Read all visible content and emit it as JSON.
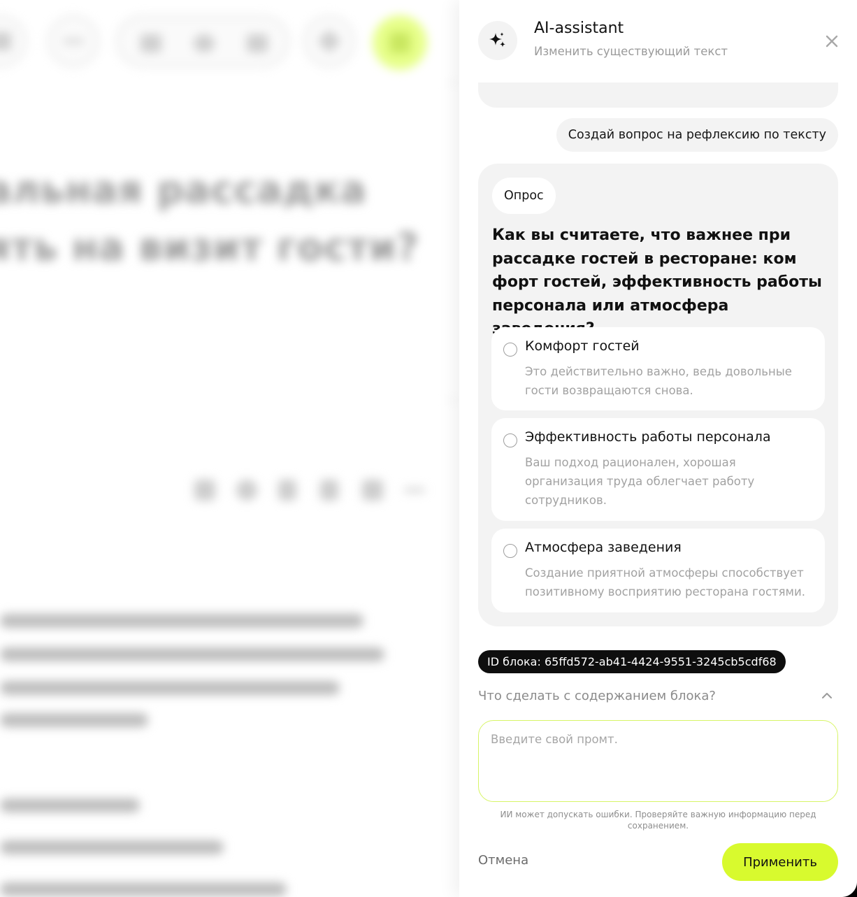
{
  "background": {
    "title_lines": [
      "альная рассадка",
      "ять на визит гости?"
    ],
    "colors": {
      "accent": "#d8fa2e",
      "accent_soft": "#e7ff8a"
    }
  },
  "assistant": {
    "title": "AI-assistant",
    "subtitle": "Изменить существующий текст",
    "icons": {
      "logo": "sparkle-icon",
      "close": "close-icon",
      "collapse": "chevron-up-icon"
    },
    "user_message": "Создай вопрос на рефлексию по тексту",
    "poll": {
      "tag": "Опрос",
      "question": "Как вы считаете, что важнее при рассадке гостей в ресторане: ком форт гостей, эффективность работы персонала или атмосфера заведения?",
      "options": [
        {
          "title": "Комфорт гостей",
          "description": "Это действительно важно, ведь довольные гости возвращаются снова."
        },
        {
          "title": "Эффективность работы персонала",
          "description": "Ваш подход рационален, хорошая организация труда облегчает работу сотрудников."
        },
        {
          "title": "Атмосфера заведения",
          "description": "Создание приятной атмосферы способствует позитивному восприятию ресторана гостями."
        }
      ]
    },
    "block_id_label": "ID блока: 65ffd572-ab41-4424-9551-3245cb5cdf68",
    "block_action_label": "Что сделать с содержанием блока?",
    "prompt": {
      "value": "",
      "placeholder": "Введите свой промт."
    },
    "disclaimer": "ИИ может допускать ошибки. Проверяйте важную информацию перед сохранением.",
    "cancel_label": "Отмена",
    "apply_label": "Применить"
  }
}
